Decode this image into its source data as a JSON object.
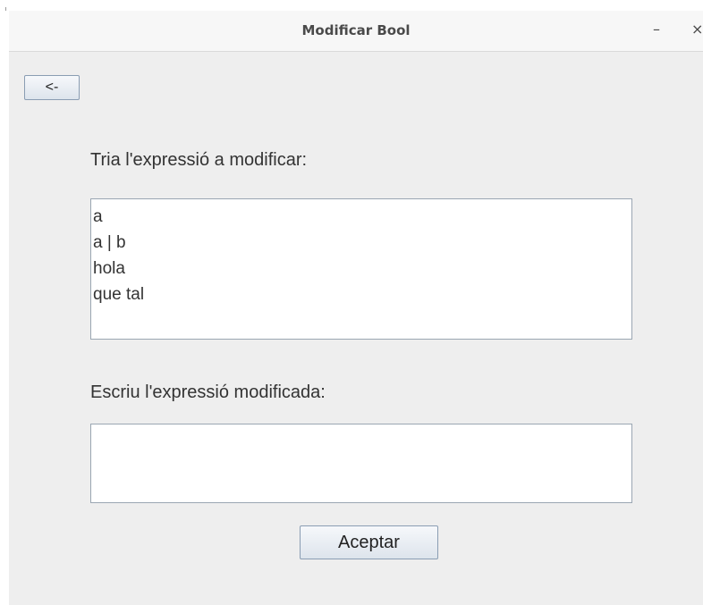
{
  "window": {
    "title": "Modificar Bool",
    "minimize_glyph": "–",
    "close_glyph": "×"
  },
  "toolbar": {
    "back_label": "<-"
  },
  "form": {
    "select_label": "Tria l'expressió a modificar:",
    "expressions": [
      "a",
      "a | b",
      "hola",
      "que tal"
    ],
    "input_label": "Escriu l'expressió modificada:",
    "input_value": "",
    "accept_label": "Aceptar"
  },
  "colors": {
    "content_background": "#eeeeee",
    "titlebar_background": "#f7f7f7",
    "button_border": "#8a9db3",
    "field_border": "#9aa6b2",
    "text": "#333333"
  },
  "icons": {
    "minimize": "minimize-icon",
    "close": "close-icon"
  }
}
